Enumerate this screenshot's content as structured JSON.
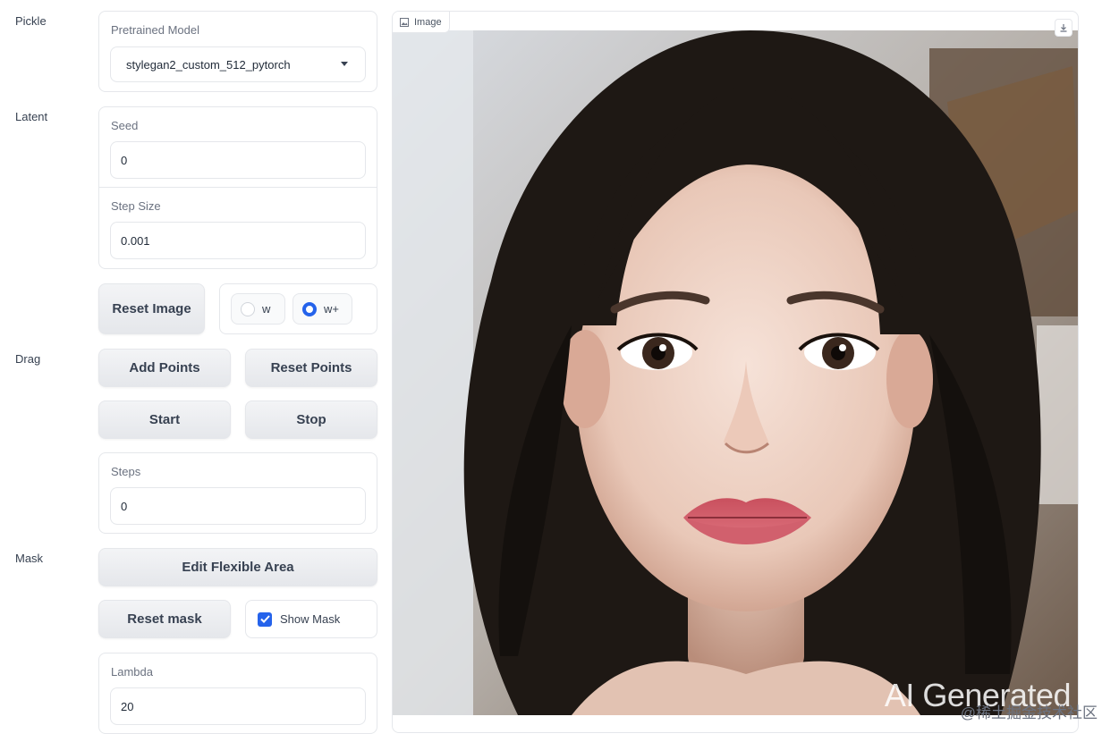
{
  "sections": {
    "pickle": "Pickle",
    "latent": "Latent",
    "drag": "Drag",
    "mask": "Mask"
  },
  "pretrained_model": {
    "label": "Pretrained Model",
    "value": "stylegan2_custom_512_pytorch",
    "icon": "caret-down-icon"
  },
  "seed": {
    "label": "Seed",
    "value": "0"
  },
  "step_size": {
    "label": "Step Size",
    "value": "0.001"
  },
  "reset_image_button": "Reset Image",
  "latent_space": {
    "options": [
      "w",
      "w+"
    ],
    "selected": "w+"
  },
  "add_points_button": "Add Points",
  "reset_points_button": "Reset Points",
  "start_button": "Start",
  "stop_button": "Stop",
  "steps": {
    "label": "Steps",
    "value": "0"
  },
  "edit_flexible_area_button": "Edit Flexible Area",
  "reset_mask_button": "Reset mask",
  "show_mask": {
    "label": "Show Mask",
    "checked": true
  },
  "lambda": {
    "label": "Lambda",
    "value": "20"
  },
  "image": {
    "tab_label": "Image",
    "tab_icon": "image-icon",
    "download_icon": "download-icon",
    "watermark": "AI Generated",
    "credit": "@稀土掘金技术社区"
  },
  "colors": {
    "accent": "#2563eb",
    "border": "#e5e7eb",
    "button_bg": "#f3f4f6"
  }
}
